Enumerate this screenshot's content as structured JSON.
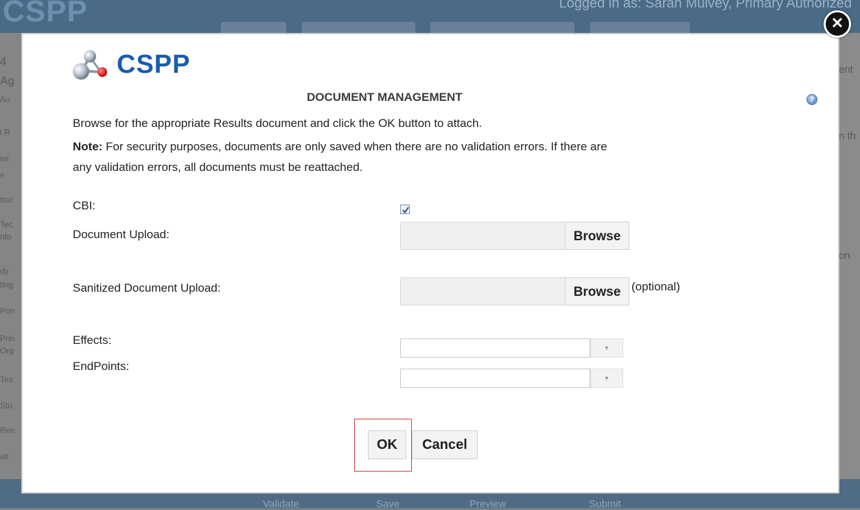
{
  "background": {
    "logo_text": "CSPP",
    "login_text": "Logged in as: Sarah Mulvey, Primary Authorized",
    "side_texts": [
      "4",
      "Ag",
      "Au",
      "l R",
      "mi",
      "e",
      "ttac",
      "Tec",
      "nfo",
      "dy",
      "ting",
      "Prin",
      "Prin",
      "Org",
      "Tes",
      "Stu",
      "Ren",
      "ult"
    ],
    "right_texts": [
      "ent",
      "n th",
      "on"
    ],
    "footer_buttons": [
      "Validate",
      "Save",
      "Preview",
      "Submit"
    ]
  },
  "modal": {
    "close_label": "✕",
    "logo_text": "CSPP",
    "help_label": "?",
    "title": "DOCUMENT MANAGEMENT",
    "instructions": "Browse for the appropriate Results document and click the OK button to attach.",
    "note_label": "Note:",
    "note_line1": " For security purposes, documents are only saved when there are no validation errors. If there are",
    "note_line2": "any validation errors, all documents must be reattached.",
    "form": {
      "cbi_label": "CBI:",
      "cbi_checked": true,
      "document_upload_label": "Document Upload:",
      "document_upload_value": "",
      "browse_label": "Browse",
      "sanitized_upload_label": "Sanitized Document Upload:",
      "sanitized_upload_value": "",
      "optional_label": "(optional)",
      "effects_label": "Effects:",
      "effects_value": "",
      "endpoints_label": "EndPoints:",
      "endpoints_value": ""
    },
    "buttons": {
      "ok_label": "OK",
      "cancel_label": "Cancel"
    },
    "colors": {
      "logo_blue": "#1a5cae",
      "highlight_red": "#d03a3a"
    }
  }
}
